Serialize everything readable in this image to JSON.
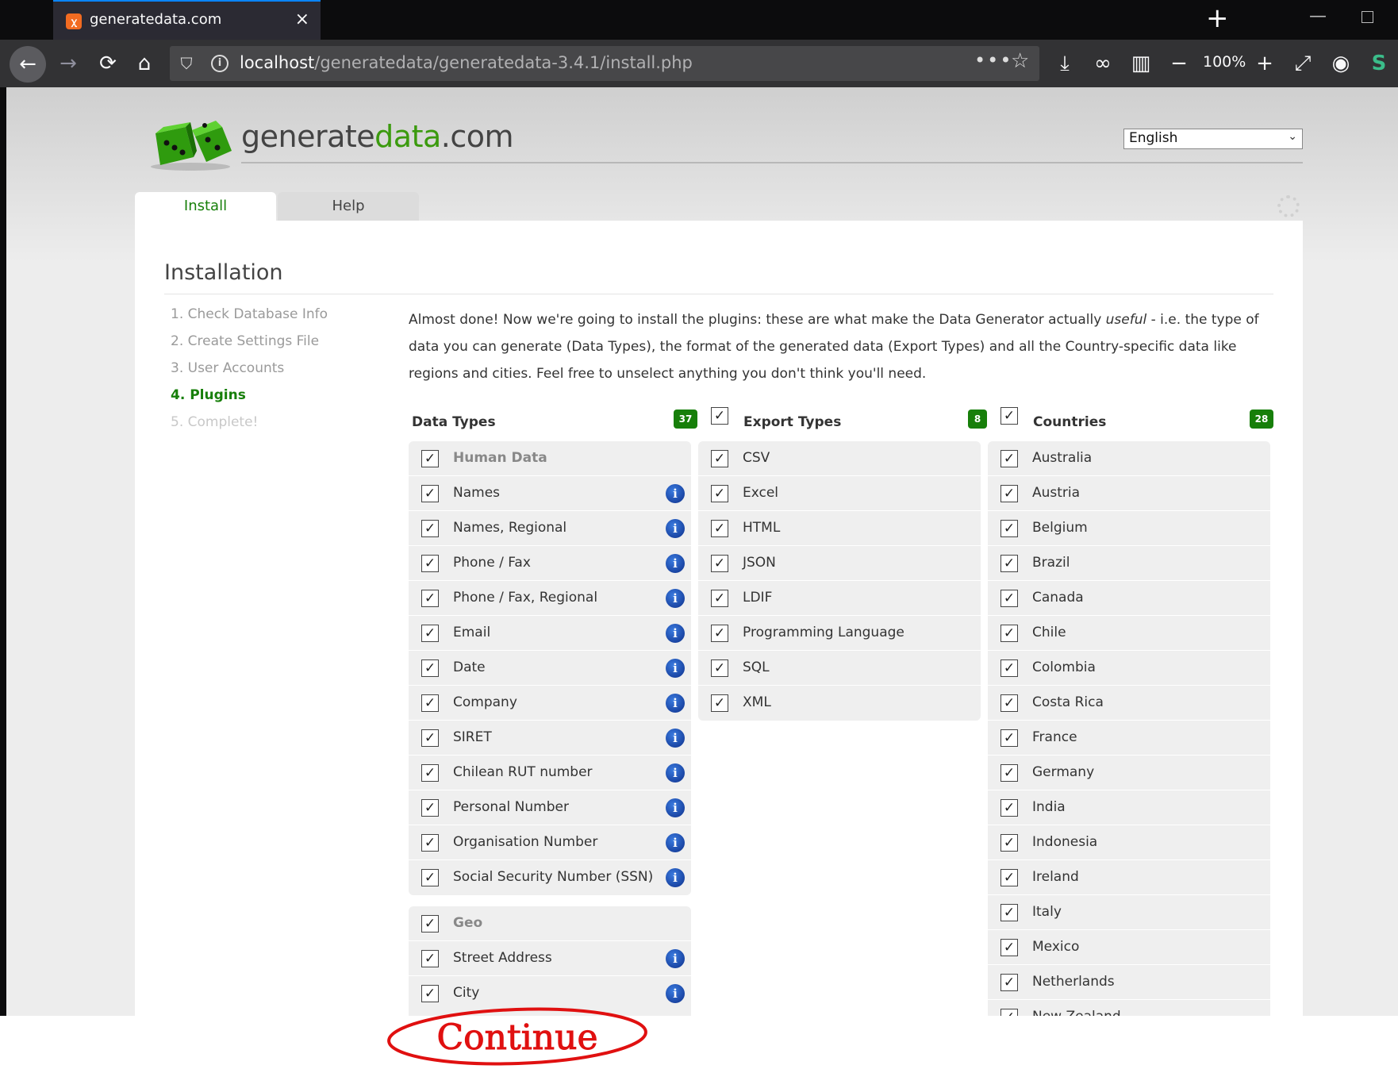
{
  "browser": {
    "tab_title": "generatedata.com",
    "tab_favicon": "xampp-icon",
    "tab_close": "×",
    "new_tab": "+",
    "url_host": "localhost",
    "url_path": "/generatedata/generatedata-3.4.1/install.php",
    "zoom": "100%",
    "more": "•••",
    "star": "☆"
  },
  "header": {
    "logo_prefix": "generate",
    "logo_accent": "data",
    "logo_suffix": ".com",
    "language": "English"
  },
  "tabs": [
    {
      "label": "Install"
    },
    {
      "label": "Help"
    }
  ],
  "page": {
    "title": "Installation",
    "steps": [
      {
        "label": "1. Check Database Info"
      },
      {
        "label": "2. Create Settings File"
      },
      {
        "label": "3. User Accounts"
      },
      {
        "label": "4. Plugins"
      },
      {
        "label": "5. Complete!"
      }
    ],
    "intro_before": "Almost done! Now we're going to install the plugins: these are what make the Data Generator actually ",
    "intro_em": "useful",
    "intro_after": " - i.e. the type of data you can generate (Data Types), the format of the generated data (Export Types) and all the Country-specific data like regions and cities. Feel free to unselect anything you don't think you'll need."
  },
  "data_types": {
    "header": "Data Types",
    "count": "37",
    "human_data": {
      "title": "Human Data",
      "items": [
        "Names",
        "Names, Regional",
        "Phone / Fax",
        "Phone / Fax, Regional",
        "Email",
        "Date",
        "Company",
        "SIRET",
        "Chilean RUT number",
        "Personal Number",
        "Organisation Number",
        "Social Security Number (SSN)"
      ]
    },
    "geo": {
      "title": "Geo",
      "items": [
        "Street Address",
        "City"
      ]
    }
  },
  "export_types": {
    "header": "Export Types",
    "count": "8",
    "items": [
      "CSV",
      "Excel",
      "HTML",
      "JSON",
      "LDIF",
      "Programming Language",
      "SQL",
      "XML"
    ]
  },
  "countries": {
    "header": "Countries",
    "count": "28",
    "items": [
      "Australia",
      "Austria",
      "Belgium",
      "Brazil",
      "Canada",
      "Chile",
      "Colombia",
      "Costa Rica",
      "France",
      "Germany",
      "India",
      "Indonesia",
      "Ireland",
      "Italy",
      "Mexico",
      "Netherlands",
      "New Zealand"
    ]
  },
  "annotation": {
    "text": "Continue",
    "color": "#e01010"
  },
  "colors": {
    "accent": "#177f0a",
    "info": "#1a4fb5",
    "tab_highlight": "#0a84ff"
  }
}
